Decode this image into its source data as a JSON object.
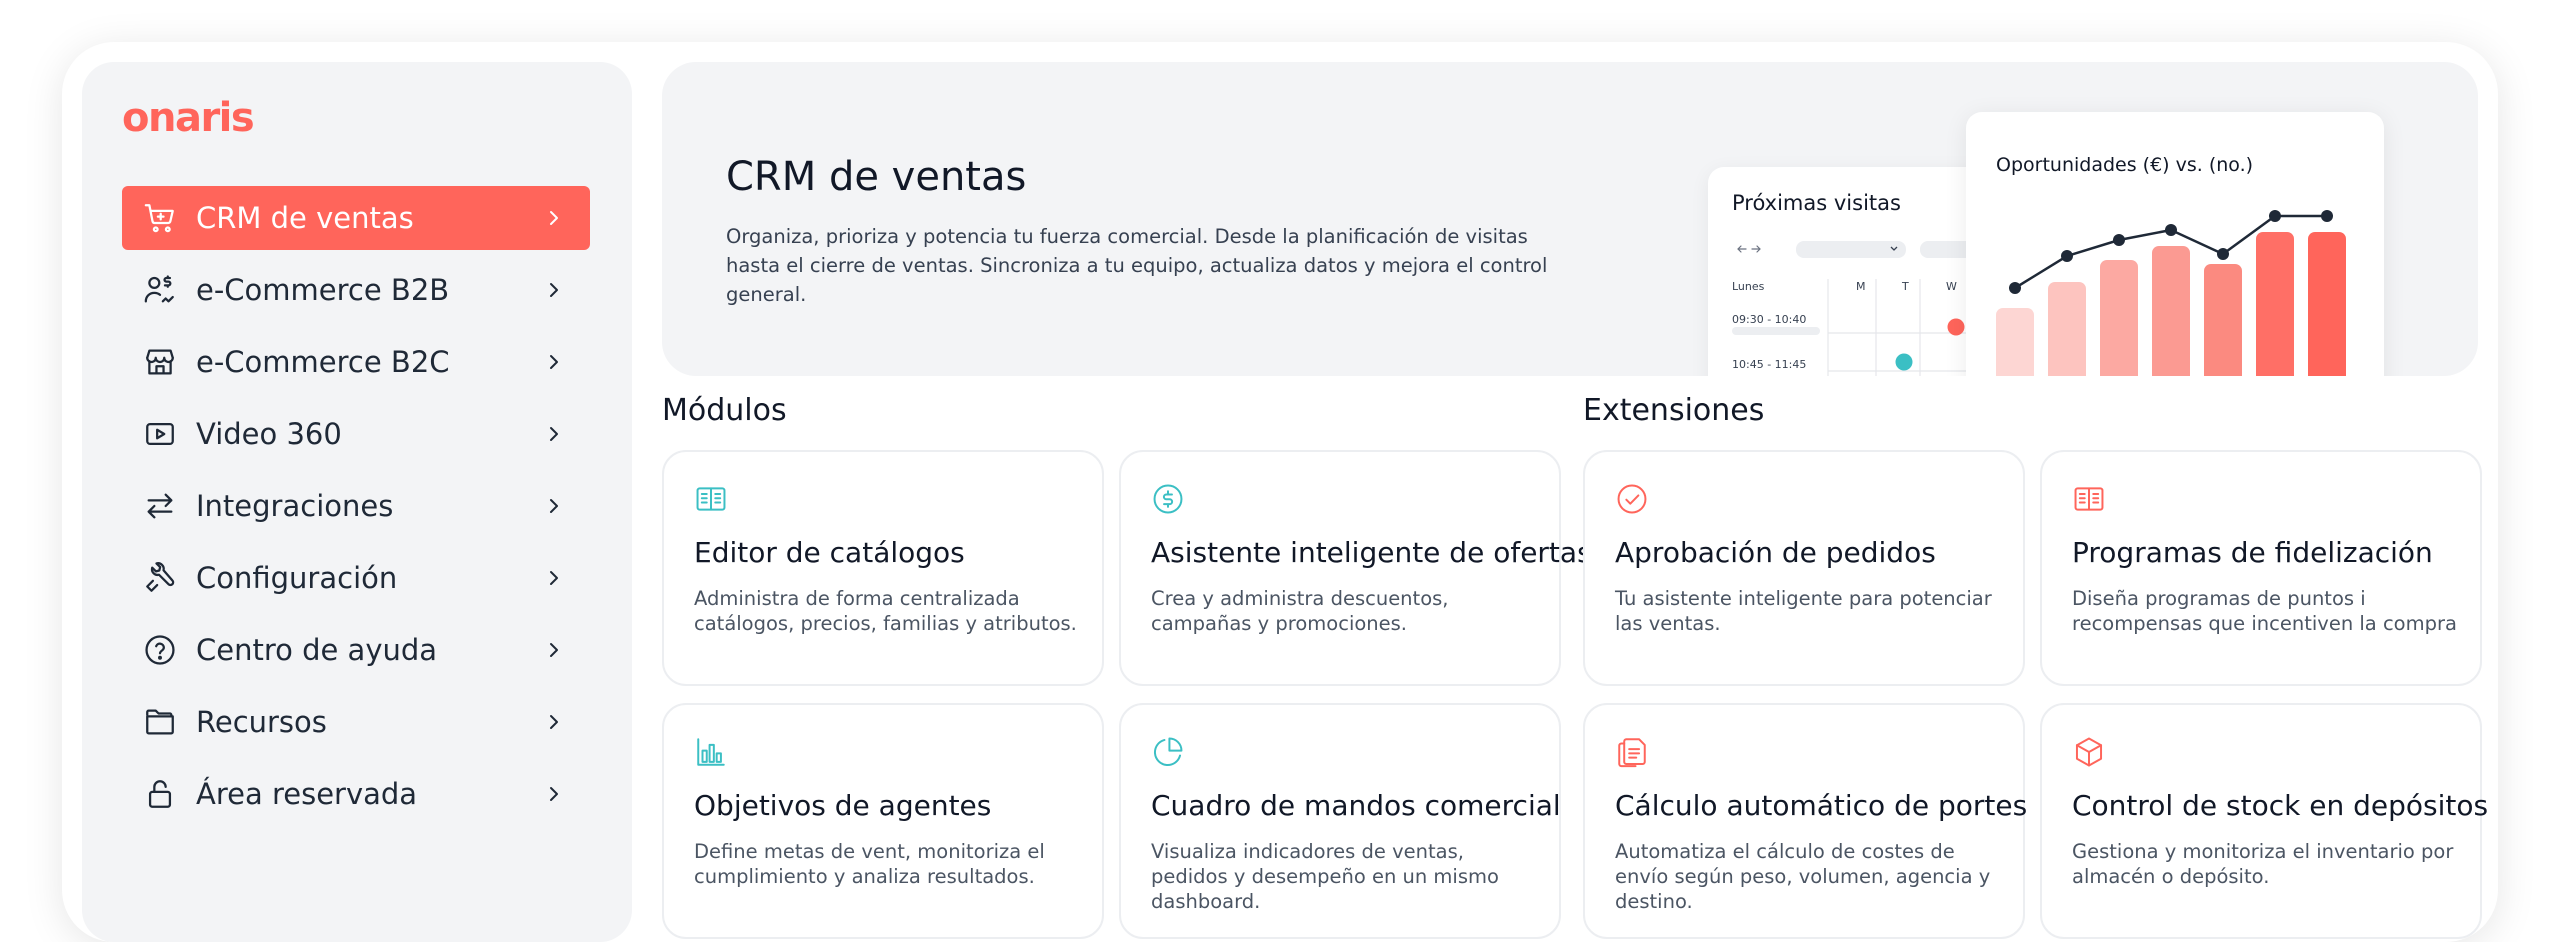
{
  "brand": {
    "logo": "onaris",
    "accent": "#ff655b",
    "teal": "#3bbfc4"
  },
  "sidebar": {
    "items": [
      {
        "label": "CRM de ventas",
        "icon": "cart-icon",
        "active": true
      },
      {
        "label": "e-Commerce B2B",
        "icon": "users-dollar-icon"
      },
      {
        "label": "e-Commerce B2C",
        "icon": "store-icon"
      },
      {
        "label": "Video 360",
        "icon": "video-icon"
      },
      {
        "label": "Integraciones",
        "icon": "arrows-exchange-icon"
      },
      {
        "label": "Configuración",
        "icon": "wrench-icon"
      },
      {
        "label": "Centro de ayuda",
        "icon": "help-circle-icon"
      },
      {
        "label": "Recursos",
        "icon": "folder-icon"
      },
      {
        "label": "Área reservada",
        "icon": "lock-icon"
      }
    ]
  },
  "hero": {
    "title": "CRM de ventas",
    "description": "Organiza, prioriza y potencia tu fuerza comercial. Desde la planificación de visitas hasta el cierre de ventas. Sincroniza a tu equipo, actualiza datos y mejora el control general.",
    "visits_card": {
      "title": "Próximas visitas",
      "day_label": "Lunes",
      "days": [
        "M",
        "T",
        "W"
      ],
      "times": [
        "09:30 - 10:40",
        "10:45 - 11:45"
      ]
    },
    "chart_card": {
      "title": "Oportunidades (€) vs. (no.)"
    }
  },
  "chart_data": {
    "type": "bar",
    "title": "Oportunidades (€) vs. (no.)",
    "categories": [
      "",
      "",
      "",
      "",
      "",
      "",
      ""
    ],
    "series": [
      {
        "values": [
          52,
          65,
          76,
          83,
          74,
          90,
          90
        ],
        "colors": [
          "#fdd6d3",
          "#fdc4bf",
          "#fca9a2",
          "#fb9a92",
          "#fb8a80",
          "#ff6f66",
          "#ff655b"
        ]
      },
      {
        "values": [
          62,
          78,
          86,
          91,
          79,
          98,
          98
        ],
        "type": "line",
        "color": "#1f2937"
      }
    ],
    "ylim": [
      0,
      100
    ]
  },
  "modules": {
    "title": "Módulos",
    "items": [
      {
        "title": "Editor de catálogos",
        "desc": "Administra de forma centralizada catálogos, precios, familias y atributos.",
        "icon": "catalog-book-icon"
      },
      {
        "title": "Asistente inteligente de ofertas",
        "desc": "Crea y administra descuentos, campañas y promociones.",
        "icon": "dollar-coin-icon"
      },
      {
        "title": "Objetivos de agentes",
        "desc": "Define metas de vent, monitoriza el cumplimiento y analiza resultados.",
        "icon": "bar-chart-icon"
      },
      {
        "title": "Cuadro de mandos comercial",
        "desc": "Visualiza indicadores de ventas, pedidos y desempeño en un mismo dashboard.",
        "icon": "pie-chart-icon"
      }
    ]
  },
  "extensions": {
    "title": "Extensiones",
    "items": [
      {
        "title": "Aprobación de pedidos",
        "desc": "Tu asistente inteligente para potenciar las ventas.",
        "icon": "check-circle-icon"
      },
      {
        "title": "Programas de fidelización",
        "desc": "Diseña programas de puntos i recompensas que incentiven la compra",
        "icon": "loyalty-book-icon"
      },
      {
        "title": "Cálculo automático de portes",
        "desc": "Automatiza el cálculo de costes de envío según peso, volumen, agencia y destino.",
        "icon": "documents-icon"
      },
      {
        "title": "Control de stock en depósitos",
        "desc": "Gestiona y monitoriza el inventario por almacén o depósito.",
        "icon": "box-icon"
      }
    ]
  }
}
